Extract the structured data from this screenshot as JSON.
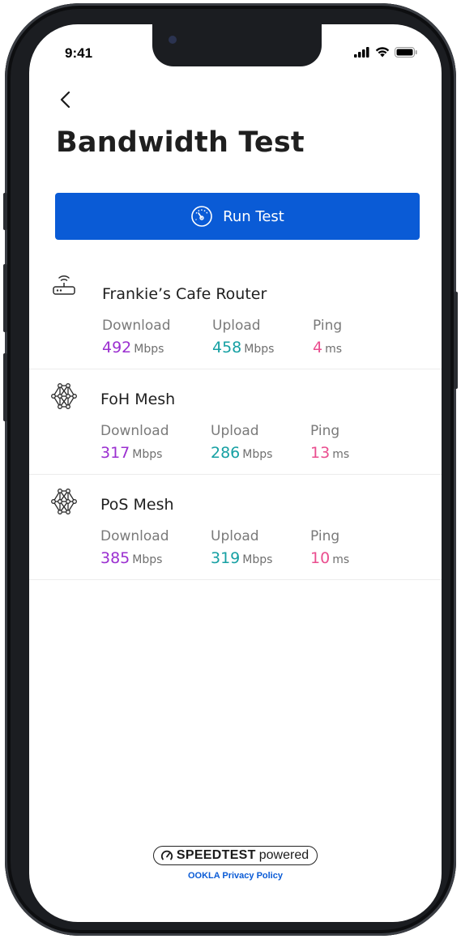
{
  "status": {
    "time": "9:41"
  },
  "header": {
    "title": "Bandwidth Test"
  },
  "actions": {
    "run_test_label": "Run Test"
  },
  "devices": [
    {
      "name": "Frankie’s Cafe Router",
      "icon": "router-icon",
      "download": "492",
      "download_unit": "Mbps",
      "download_label": "Download",
      "upload": "458",
      "upload_unit": "Mbps",
      "upload_label": "Upload",
      "ping": "4",
      "ping_unit": "ms",
      "ping_label": "Ping"
    },
    {
      "name": "FoH Mesh",
      "icon": "mesh-network-icon",
      "download": "317",
      "download_unit": "Mbps",
      "download_label": "Download",
      "upload": "286",
      "upload_unit": "Mbps",
      "upload_label": "Upload",
      "ping": "13",
      "ping_unit": "ms",
      "ping_label": "Ping"
    },
    {
      "name": "PoS Mesh",
      "icon": "mesh-network-icon",
      "download": "385",
      "download_unit": "Mbps",
      "download_label": "Download",
      "upload": "319",
      "upload_unit": "Mbps",
      "upload_label": "Upload",
      "ping": "10",
      "ping_unit": "ms",
      "ping_label": "Ping"
    }
  ],
  "footer": {
    "brand": "SPEEDTEST",
    "powered": "powered",
    "privacy_link": "OOKLA Privacy Policy"
  },
  "colors": {
    "accent": "#0a5bd6",
    "download": "#9b2fd0",
    "upload": "#16a0a3",
    "ping": "#ea4e8f"
  }
}
